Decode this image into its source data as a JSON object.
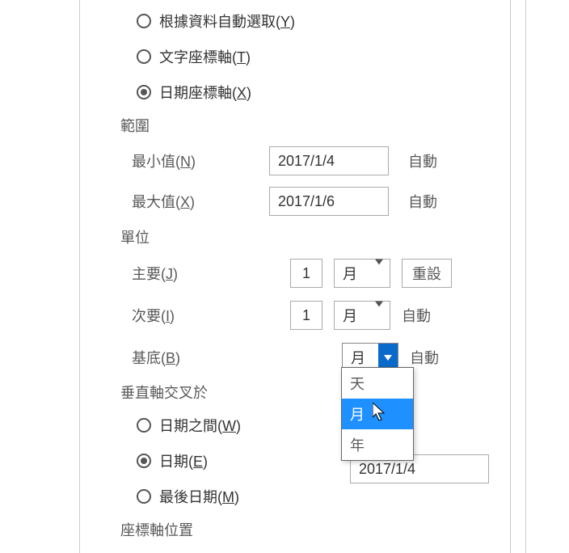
{
  "axis_type": {
    "auto_label": "根據資料自動選取(Y)",
    "text_label": "文字座標軸(T)",
    "date_label": "日期座標軸(X)",
    "selected": "date"
  },
  "range": {
    "header": "範圍",
    "min_label": "最小值(N)",
    "min_value": "2017/1/4",
    "min_auto": "自動",
    "max_label": "最大值(X)",
    "max_value": "2017/1/6",
    "max_auto": "自動"
  },
  "units": {
    "header": "單位",
    "major_label": "主要(J)",
    "major_value": "1",
    "major_unit": "月",
    "reset_label": "重設",
    "minor_label": "次要(I)",
    "minor_value": "1",
    "minor_unit": "月",
    "minor_auto": "自動",
    "base_label": "基底(B)",
    "base_unit": "月",
    "base_auto": "自動",
    "dropdown": {
      "opt_day": "天",
      "opt_month": "月",
      "opt_year": "年"
    }
  },
  "vcross": {
    "header": "垂直軸交叉於",
    "between_label": "日期之間(W)",
    "date_label": "日期(E)",
    "date_value": "2017/1/4",
    "last_label": "最後日期(M)",
    "selected": "date"
  },
  "axis_pos": {
    "header": "座標軸位置"
  }
}
